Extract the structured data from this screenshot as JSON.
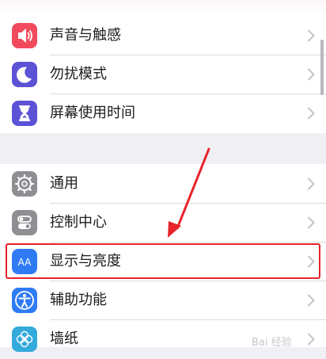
{
  "settings": {
    "group1": [
      {
        "label": "声音与触感",
        "icon": "speaker-icon",
        "color": "#f04a5c"
      },
      {
        "label": "勿扰模式",
        "icon": "moon-icon",
        "color": "#5b52d6"
      },
      {
        "label": "屏幕使用时间",
        "icon": "hourglass-icon",
        "color": "#5b52d6"
      }
    ],
    "group2": [
      {
        "label": "通用",
        "icon": "gear-icon",
        "color": "#8e8e93"
      },
      {
        "label": "控制中心",
        "icon": "toggles-icon",
        "color": "#8e8e93"
      },
      {
        "label": "显示与亮度",
        "icon": "display-aa-icon",
        "color": "#2f7bf5"
      },
      {
        "label": "辅助功能",
        "icon": "accessibility-icon",
        "color": "#2f7bf5"
      },
      {
        "label": "墙纸",
        "icon": "wallpaper-flower-icon",
        "color": "#35aadc"
      }
    ]
  },
  "icon_text": {
    "display": "AA"
  },
  "annotation": {
    "highlight_color": "#e8232a"
  },
  "watermark": "Bai 经验"
}
